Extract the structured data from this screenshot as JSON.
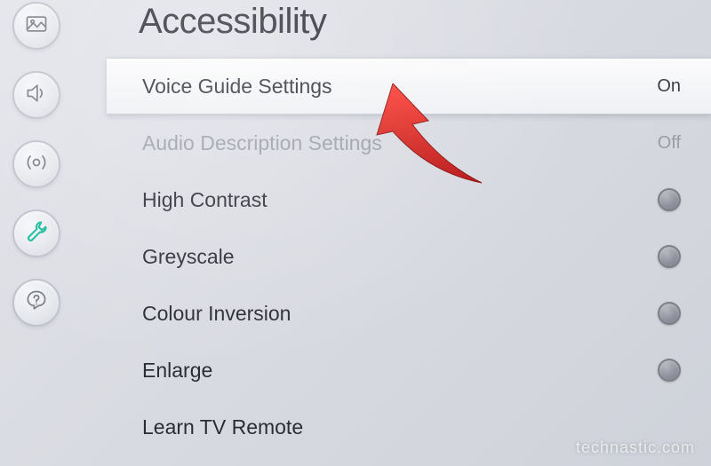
{
  "page": {
    "title": "Accessibility"
  },
  "sidebar": {
    "items": [
      {
        "name": "picture-icon"
      },
      {
        "name": "sound-icon"
      },
      {
        "name": "broadcast-icon"
      },
      {
        "name": "general-icon"
      },
      {
        "name": "support-icon"
      }
    ]
  },
  "rows": {
    "voice_guide": {
      "label": "Voice Guide Settings",
      "value": "On"
    },
    "audio_desc": {
      "label": "Audio Description Settings",
      "value": "Off"
    },
    "high_contrast": {
      "label": "High Contrast"
    },
    "greyscale": {
      "label": "Greyscale"
    },
    "colour_inversion": {
      "label": "Colour Inversion"
    },
    "enlarge": {
      "label": "Enlarge"
    },
    "learn_tv_remote": {
      "label": "Learn TV Remote"
    }
  },
  "watermark": "technastic.com",
  "colors": {
    "accent": "#1abc9c",
    "arrow": "#d62121"
  }
}
